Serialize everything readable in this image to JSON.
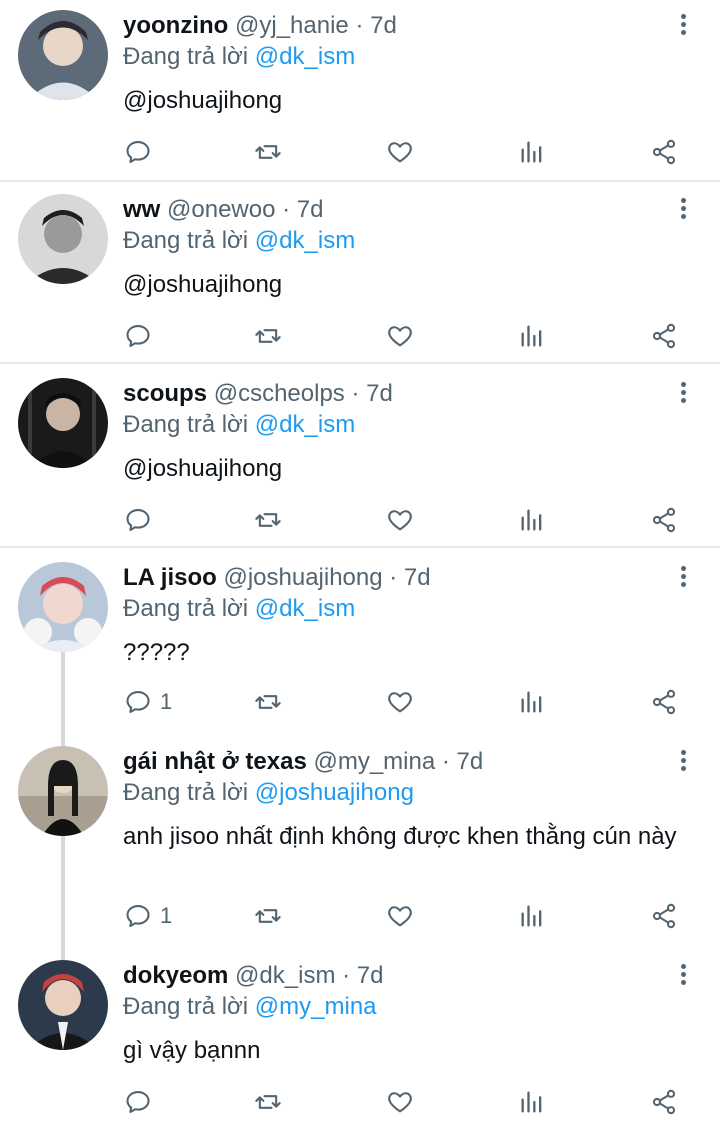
{
  "reply_prefix": "Đang trả lời",
  "colors": {
    "accent": "#1d9bf0",
    "muted": "#536471",
    "text": "#0f1419",
    "divider": "#e6e9ec"
  },
  "tweets": [
    {
      "name": "yoonzino",
      "handle": "@yj_hanie",
      "time": "· 7d",
      "reply_to": "@dk_ism",
      "text": "@joshuajihong",
      "text_is_mention": true,
      "reply_count": ""
    },
    {
      "name": "ww",
      "handle": "@onewoo",
      "time": "· 7d",
      "reply_to": "@dk_ism",
      "text": "@joshuajihong",
      "text_is_mention": true,
      "reply_count": ""
    },
    {
      "name": "scoups",
      "handle": "@cscheolps",
      "time": "· 7d",
      "reply_to": "@dk_ism",
      "text": "@joshuajihong",
      "text_is_mention": true,
      "reply_count": ""
    },
    {
      "name": "LA jisoo",
      "handle": "@joshuajihong",
      "time": "· 7d",
      "reply_to": "@dk_ism",
      "text": "?????",
      "text_is_mention": false,
      "reply_count": "1"
    },
    {
      "name": "gái nhật ở texas",
      "handle": "@my_mina",
      "time": "· 7d",
      "reply_to": "@joshuajihong",
      "text": "anh jisoo nhất định không được khen thằng cún này",
      "text_is_mention": false,
      "reply_count": "1"
    },
    {
      "name": "dokyeom",
      "handle": "@dk_ism",
      "time": "· 7d",
      "reply_to": "@my_mina",
      "text": "gì vậy bạnnn",
      "text_is_mention": false,
      "reply_count": ""
    }
  ],
  "icons": {
    "more": "more-vertical-icon",
    "reply": "reply-icon",
    "retweet": "retweet-icon",
    "like": "heart-icon",
    "views": "views-icon",
    "share": "share-icon"
  }
}
